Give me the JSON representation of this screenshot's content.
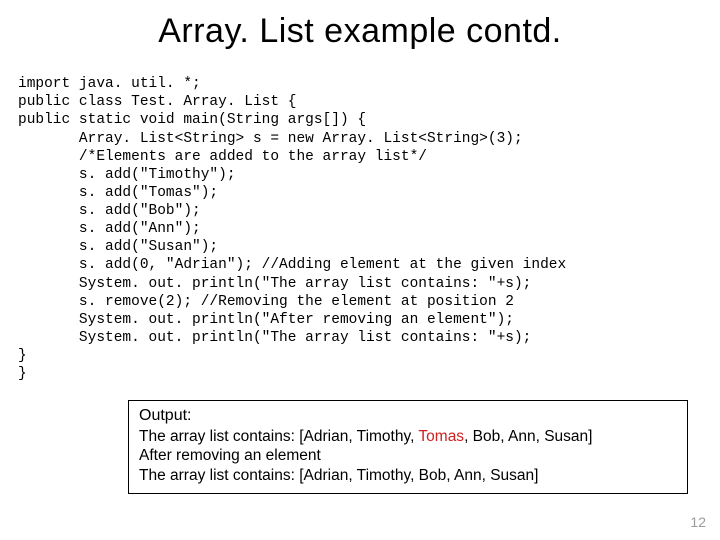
{
  "title": "Array. List example contd.",
  "code": {
    "l1": "import java. util. *;",
    "l2": "public class Test. Array. List {",
    "l3": "public static void main(String args[]) {",
    "l4": "       Array. List<String> s = new Array. List<String>(3);",
    "l5": "       /*Elements are added to the array list*/",
    "l6": "       s. add(\"Timothy\");",
    "l7": "       s. add(\"Tomas\");",
    "l8": "       s. add(\"Bob\");",
    "l9": "       s. add(\"Ann\");",
    "l10": "       s. add(\"Susan\");",
    "l11": "       s. add(0, \"Adrian\"); //Adding element at the given index",
    "l12": "       System. out. println(\"The array list contains: \"+s);",
    "l13": "       s. remove(2); //Removing the element at position 2",
    "l14": "       System. out. println(\"After removing an element\");",
    "l15": "       System. out. println(\"The array list contains: \"+s);",
    "l16": "}",
    "l17": "}"
  },
  "output": {
    "label": "Output:",
    "line1_pre": "The array list contains: [Adrian, Timothy, ",
    "line1_hl": "Tomas",
    "line1_post": ", Bob, Ann, Susan]",
    "line2": "After removing an element",
    "line3": "The array list contains: [Adrian, Timothy, Bob, Ann, Susan]"
  },
  "page_number": "12"
}
